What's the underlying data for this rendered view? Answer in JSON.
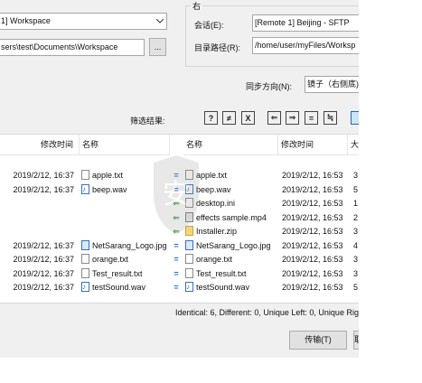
{
  "local": {
    "session_value": "1] Workspace",
    "path_value": "sers\\test\\Documents\\Workspace",
    "browse_label": "..."
  },
  "remote_group": {
    "title": "右",
    "session_label": "会话(E):",
    "session_value": "[Remote 1] Beijing - SFTP",
    "path_label": "目录路径(R):",
    "path_value": "/home/user/myFiles/Worksp"
  },
  "sync": {
    "label": "同步方向(N):",
    "value": "镜子（右侧底)"
  },
  "filter": {
    "label": "筛选结果:",
    "buttons": [
      {
        "name": "show-all",
        "glyph": "?"
      },
      {
        "name": "show-different",
        "glyph": "≠"
      },
      {
        "name": "show-unique",
        "glyph": "X"
      },
      {
        "name": "show-left",
        "glyph": "⇐"
      },
      {
        "name": "show-right",
        "glyph": "⇒"
      },
      {
        "name": "show-identical",
        "glyph": "="
      },
      {
        "name": "show-changed",
        "glyph": "≒"
      }
    ]
  },
  "left_list": {
    "col_modified": "修改时间",
    "col_name": "名称"
  },
  "right_list": {
    "col_name": "名称",
    "col_modified": "修改时间",
    "col_size": "大"
  },
  "rows": [
    {
      "l_time": "2019/2/12, 16:37",
      "l_name": "apple.txt",
      "l_type": "txt",
      "cmp": "=",
      "cmp_type": "eq",
      "r_name": "apple.txt",
      "r_type": "txt",
      "r_time": "2019/2/12, 16:53",
      "r_size": "3"
    },
    {
      "l_time": "2019/2/12, 16:37",
      "l_name": "beep.wav",
      "l_type": "wav",
      "cmp": "=",
      "cmp_type": "eq",
      "r_name": "beep.wav",
      "r_type": "wav",
      "r_time": "2019/2/12, 16:53",
      "r_size": "5"
    },
    {
      "l_time": "",
      "l_name": "",
      "l_type": "",
      "cmp": "⇐",
      "cmp_type": "left",
      "r_name": "desktop.ini",
      "r_type": "txt",
      "r_time": "2019/2/12, 16:53",
      "r_size": "1"
    },
    {
      "l_time": "",
      "l_name": "",
      "l_type": "",
      "cmp": "⇐",
      "cmp_type": "left",
      "r_name": "effects sample.mp4",
      "r_type": "mp4",
      "r_time": "2019/2/12, 16:53",
      "r_size": "2"
    },
    {
      "l_time": "",
      "l_name": "",
      "l_type": "",
      "cmp": "⇐",
      "cmp_type": "left",
      "r_name": "Installer.zip",
      "r_type": "zip",
      "r_time": "2019/2/12, 16:53",
      "r_size": "3"
    },
    {
      "l_time": "2019/2/12, 16:37",
      "l_name": "NetSarang_Logo.jpg",
      "l_type": "jpg",
      "cmp": "=",
      "cmp_type": "eq",
      "r_name": "NetSarang_Logo.jpg",
      "r_type": "jpg",
      "r_time": "2019/2/12, 16:53",
      "r_size": "4"
    },
    {
      "l_time": "2019/2/12, 16:37",
      "l_name": "orange.txt",
      "l_type": "txt",
      "cmp": "=",
      "cmp_type": "eq",
      "r_name": "orange.txt",
      "r_type": "txt",
      "r_time": "2019/2/12, 16:53",
      "r_size": "3"
    },
    {
      "l_time": "2019/2/12, 16:37",
      "l_name": "Test_result.txt",
      "l_type": "txt",
      "cmp": "=",
      "cmp_type": "eq",
      "r_name": "Test_result.txt",
      "r_type": "txt",
      "r_time": "2019/2/12, 16:53",
      "r_size": "3"
    },
    {
      "l_time": "2019/2/12, 16:37",
      "l_name": "testSound.wav",
      "l_type": "wav",
      "cmp": "=",
      "cmp_type": "eq",
      "r_name": "testSound.wav",
      "r_type": "wav",
      "r_time": "2019/2/12, 16:53",
      "r_size": "5"
    }
  ],
  "summary": "Identical: 6, Different: 0, Unique Left: 0, Unique Rig",
  "buttons": {
    "transfer_label": "传输(T)",
    "second_label": "取"
  },
  "colors": {
    "equal": "#1e6cc8",
    "left_arrow": "#2f9a2f",
    "selected_tool": "#cce4f7"
  }
}
